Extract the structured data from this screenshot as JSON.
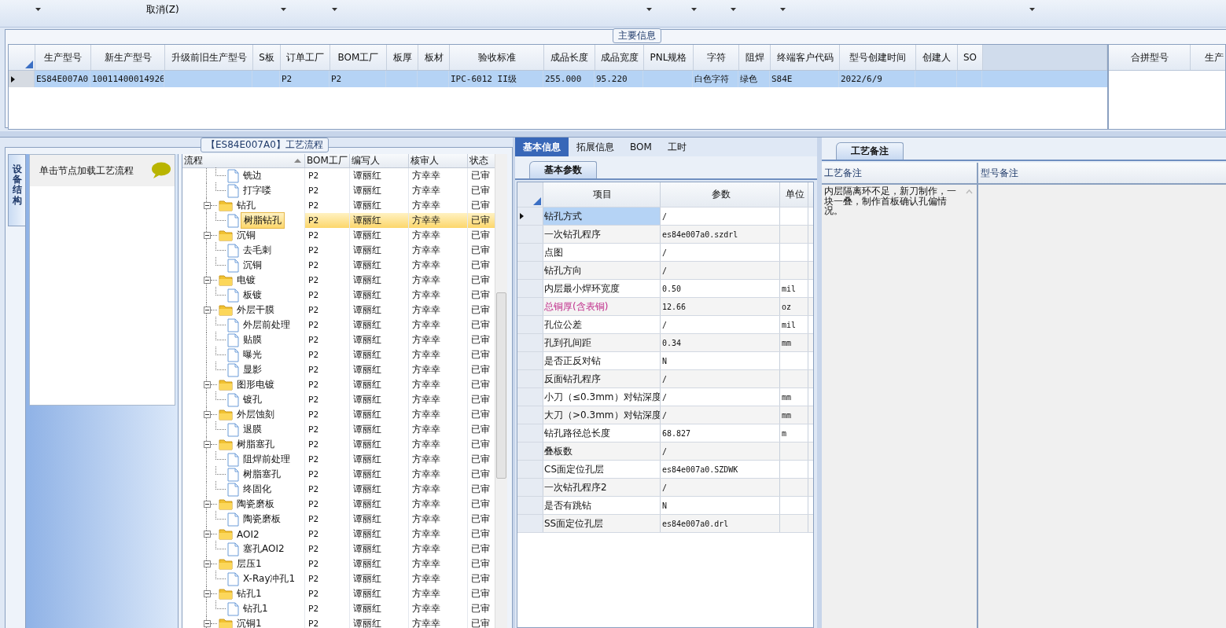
{
  "toolbar": {
    "cancel_button": "取消(Z)"
  },
  "main_info": {
    "title": "主要信息",
    "columns": [
      "生产型号",
      "新生产型号",
      "升级前旧生产型号",
      "S板",
      "订单工厂",
      "BOM工厂",
      "板厚",
      "板材",
      "验收标准",
      "成品长度",
      "成品宽度",
      "PNL规格",
      "字符",
      "阻焊",
      "终端客户代码",
      "型号创建时间",
      "创建人",
      "SO"
    ],
    "rows": [
      {
        "selected": true,
        "cells": [
          "ES84E007A0",
          "10011400014926",
          null,
          null,
          "P2",
          "P2",
          null,
          null,
          "IPC-6012 II级",
          "255.000",
          "95.220",
          null,
          "白色字符",
          "绿色",
          "S84E",
          "2022/6/9",
          null,
          null
        ]
      }
    ],
    "side_columns": [
      "合拼型号",
      "生产"
    ]
  },
  "process": {
    "title": "【ES84E007A0】工艺流程",
    "side_tab": "设备结构",
    "hint": "单击节点加载工艺流程",
    "columns": [
      "流程",
      "BOM工厂",
      "编写人",
      "核审人",
      "状态"
    ],
    "nodes": [
      {
        "label": "铣边",
        "bom": "P2",
        "writer": "谭丽红",
        "reviewer": "方幸幸",
        "status": "已审",
        "selected": false
      },
      {
        "label": "打字喽",
        "bom": "P2",
        "writer": "谭丽红",
        "reviewer": "方幸幸",
        "status": "已审",
        "selected": false
      },
      {
        "label": "钻孔",
        "bom": "P2",
        "writer": "谭丽红",
        "reviewer": "方幸幸",
        "status": "已审",
        "selected": false,
        "expanded": true,
        "children": [
          {
            "label": "树脂钻孔",
            "bom": "P2",
            "writer": "谭丽红",
            "reviewer": "方幸幸",
            "status": "已审",
            "selected": true
          }
        ]
      },
      {
        "label": "沉铜",
        "bom": "P2",
        "writer": "谭丽红",
        "reviewer": "方幸幸",
        "status": "已审",
        "selected": false,
        "expanded": true,
        "children": [
          {
            "label": "去毛刺",
            "bom": "P2",
            "writer": "谭丽红",
            "reviewer": "方幸幸",
            "status": "已审",
            "selected": false
          },
          {
            "label": "沉铜",
            "bom": "P2",
            "writer": "谭丽红",
            "reviewer": "方幸幸",
            "status": "已审",
            "selected": false
          }
        ]
      },
      {
        "label": "电镀",
        "bom": "P2",
        "writer": "谭丽红",
        "reviewer": "方幸幸",
        "status": "已审",
        "selected": false,
        "expanded": true,
        "children": [
          {
            "label": "板镀",
            "bom": "P2",
            "writer": "谭丽红",
            "reviewer": "方幸幸",
            "status": "已审",
            "selected": false
          }
        ]
      },
      {
        "label": "外层干膜",
        "bom": "P2",
        "writer": "谭丽红",
        "reviewer": "方幸幸",
        "status": "已审",
        "selected": false,
        "expanded": true,
        "children": [
          {
            "label": "外层前处理",
            "bom": "P2",
            "writer": "谭丽红",
            "reviewer": "方幸幸",
            "status": "已审",
            "selected": false
          },
          {
            "label": "贴膜",
            "bom": "P2",
            "writer": "谭丽红",
            "reviewer": "方幸幸",
            "status": "已审",
            "selected": false
          },
          {
            "label": "曝光",
            "bom": "P2",
            "writer": "谭丽红",
            "reviewer": "方幸幸",
            "status": "已审",
            "selected": false
          },
          {
            "label": "显影",
            "bom": "P2",
            "writer": "谭丽红",
            "reviewer": "方幸幸",
            "status": "已审",
            "selected": false
          }
        ]
      },
      {
        "label": "图形电镀",
        "bom": "P2",
        "writer": "谭丽红",
        "reviewer": "方幸幸",
        "status": "已审",
        "selected": false,
        "expanded": true,
        "children": [
          {
            "label": "镀孔",
            "bom": "P2",
            "writer": "谭丽红",
            "reviewer": "方幸幸",
            "status": "已审",
            "selected": false
          }
        ]
      },
      {
        "label": "外层蚀刻",
        "bom": "P2",
        "writer": "谭丽红",
        "reviewer": "方幸幸",
        "status": "已审",
        "selected": false,
        "expanded": true,
        "children": [
          {
            "label": "退膜",
            "bom": "P2",
            "writer": "谭丽红",
            "reviewer": "方幸幸",
            "status": "已审",
            "selected": false
          }
        ]
      },
      {
        "label": "树脂塞孔",
        "bom": "P2",
        "writer": "谭丽红",
        "reviewer": "方幸幸",
        "status": "已审",
        "selected": false,
        "expanded": true,
        "children": [
          {
            "label": "阻焊前处理",
            "bom": "P2",
            "writer": "谭丽红",
            "reviewer": "方幸幸",
            "status": "已审",
            "selected": false
          },
          {
            "label": "树脂塞孔",
            "bom": "P2",
            "writer": "谭丽红",
            "reviewer": "方幸幸",
            "status": "已审",
            "selected": false
          },
          {
            "label": "终固化",
            "bom": "P2",
            "writer": "谭丽红",
            "reviewer": "方幸幸",
            "status": "已审",
            "selected": false
          }
        ]
      },
      {
        "label": "陶瓷磨板",
        "bom": "P2",
        "writer": "谭丽红",
        "reviewer": "方幸幸",
        "status": "已审",
        "selected": false,
        "expanded": true,
        "children": [
          {
            "label": "陶瓷磨板",
            "bom": "P2",
            "writer": "谭丽红",
            "reviewer": "方幸幸",
            "status": "已审",
            "selected": false
          }
        ]
      },
      {
        "label": "AOI2",
        "bom": "P2",
        "writer": "谭丽红",
        "reviewer": "方幸幸",
        "status": "已审",
        "selected": false,
        "expanded": true,
        "children": [
          {
            "label": "塞孔AOI2",
            "bom": "P2",
            "writer": "谭丽红",
            "reviewer": "方幸幸",
            "status": "已审",
            "selected": false
          }
        ]
      },
      {
        "label": "层压1",
        "bom": "P2",
        "writer": "谭丽红",
        "reviewer": "方幸幸",
        "status": "已审",
        "selected": false,
        "expanded": true,
        "children": [
          {
            "label": "X-Ray冲孔1",
            "bom": "P2",
            "writer": "谭丽红",
            "reviewer": "方幸幸",
            "status": "已审",
            "selected": false
          }
        ]
      },
      {
        "label": "钻孔1",
        "bom": "P2",
        "writer": "谭丽红",
        "reviewer": "方幸幸",
        "status": "已审",
        "selected": false,
        "expanded": true,
        "children": [
          {
            "label": "钻孔1",
            "bom": "P2",
            "writer": "谭丽红",
            "reviewer": "方幸幸",
            "status": "已审",
            "selected": false
          }
        ]
      },
      {
        "label": "沉铜1",
        "bom": "P2",
        "writer": "谭丽红",
        "reviewer": "方幸幸",
        "status": "已审",
        "selected": false,
        "expanded": true
      }
    ]
  },
  "detail": {
    "tabs": [
      {
        "label": "基本信息",
        "selected": true
      },
      {
        "label": "拓展信息",
        "selected": false
      },
      {
        "label": "BOM",
        "selected": false
      },
      {
        "label": "工时",
        "selected": false
      }
    ],
    "subtab": "基本参数",
    "columns": [
      "项目",
      "参数",
      "单位"
    ],
    "rows": [
      {
        "item": "钻孔方式",
        "value": "/",
        "selected": true,
        "emphasized": false
      },
      {
        "item": "一次钻孔程序",
        "value": "es84e007a0.szdrl",
        "selected": false,
        "emphasized": false
      },
      {
        "item": "点图",
        "value": "/",
        "selected": false,
        "emphasized": false
      },
      {
        "item": "钻孔方向",
        "value": "/",
        "selected": false,
        "emphasized": false
      },
      {
        "item": "内层最小焊环宽度",
        "value": "0.50",
        "unit": "mil",
        "selected": false,
        "emphasized": false
      },
      {
        "item": "总铜厚(含表铜)",
        "value": "12.66",
        "unit": "oz",
        "selected": false,
        "emphasized": true
      },
      {
        "item": "孔位公差",
        "value": "/",
        "unit": "mil",
        "selected": false,
        "emphasized": false
      },
      {
        "item": "孔到孔间距",
        "value": "0.34",
        "unit": "mm",
        "selected": false,
        "emphasized": false
      },
      {
        "item": "是否正反对钻",
        "value": "N",
        "selected": false,
        "emphasized": false
      },
      {
        "item": "反面钻孔程序",
        "value": "/",
        "selected": false,
        "emphasized": false
      },
      {
        "item": "小刀（≤0.3mm）对钻深度",
        "value": "/",
        "unit": "mm",
        "selected": false,
        "emphasized": false
      },
      {
        "item": "大刀（>0.3mm）对钻深度",
        "value": "/",
        "unit": "mm",
        "selected": false,
        "emphasized": false
      },
      {
        "item": "钻孔路径总长度",
        "value": "68.827",
        "unit": "m",
        "selected": false,
        "emphasized": false
      },
      {
        "item": "叠板数",
        "value": "/",
        "selected": false,
        "emphasized": false
      },
      {
        "item": "CS面定位孔层",
        "value": "es84e007a0.SZDWK",
        "selected": false,
        "emphasized": false
      },
      {
        "item": "一次钻孔程序2",
        "value": "/",
        "selected": false,
        "emphasized": false
      },
      {
        "item": "是否有跳钻",
        "value": "N",
        "selected": false,
        "emphasized": false
      },
      {
        "item": "SS面定位孔层",
        "value": "es84e007a0.drl",
        "selected": false,
        "emphasized": false
      }
    ]
  },
  "remarks": {
    "tab": "工艺备注",
    "columns": [
      "工艺备注",
      "型号备注"
    ],
    "process_note": "内层隔离环不足，新刀制作，一块一叠，制作首板确认孔偏情况。"
  }
}
